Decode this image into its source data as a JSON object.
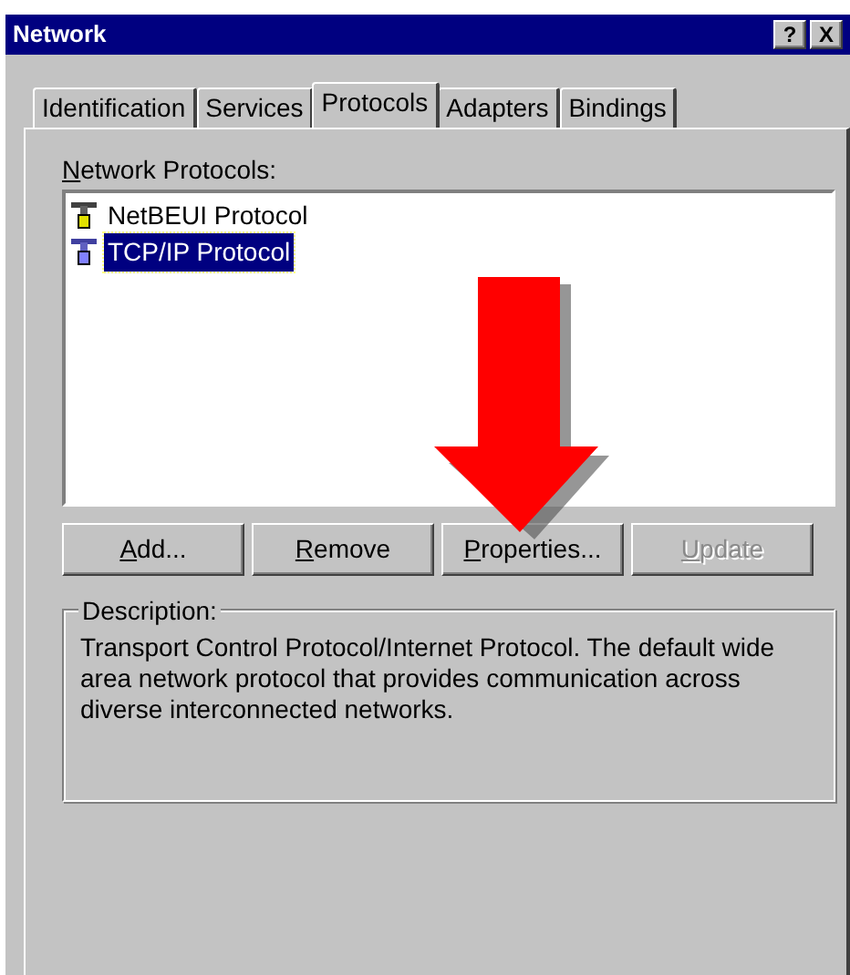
{
  "window": {
    "title": "Network",
    "title_buttons": [
      "?",
      "X"
    ]
  },
  "tabs": [
    {
      "label": "Identification",
      "selected": false
    },
    {
      "label": "Services",
      "selected": false
    },
    {
      "label": "Protocols",
      "selected": true
    },
    {
      "label": "Adapters",
      "selected": false
    },
    {
      "label": "Bindings",
      "selected": false
    }
  ],
  "protocols_label": {
    "accel": "N",
    "rest": "etwork Protocols:"
  },
  "protocols": [
    {
      "name": "NetBEUI Protocol",
      "selected": false
    },
    {
      "name": "TCP/IP Protocol",
      "selected": true
    }
  ],
  "buttons": [
    {
      "accel": "A",
      "rest": "dd...",
      "disabled": false
    },
    {
      "accel": "R",
      "rest": "emove",
      "disabled": false
    },
    {
      "accel": "P",
      "rest": "roperties...",
      "disabled": false
    },
    {
      "accel": "U",
      "rest": "pdate",
      "disabled": true
    }
  ],
  "description": {
    "label": "Description:",
    "text": "Transport Control Protocol/Internet Protocol. The default wide area network protocol that provides communication across diverse interconnected networks."
  }
}
